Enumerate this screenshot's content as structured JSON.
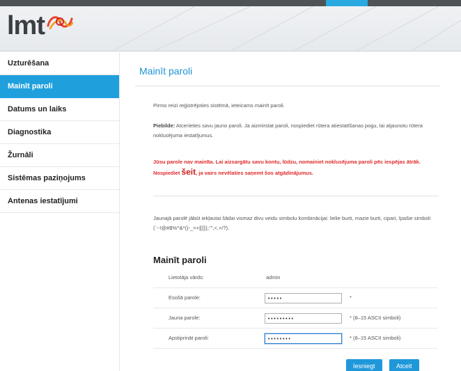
{
  "brand": {
    "logo_text": "lmt",
    "accent_color": "#1fa0dd",
    "warn_color": "#e02a2a"
  },
  "sidebar": {
    "items": [
      {
        "label": "Uzturēšana",
        "active": false
      },
      {
        "label": "Mainīt paroli",
        "active": true
      },
      {
        "label": "Datums un laiks",
        "active": false
      },
      {
        "label": "Diagnostika",
        "active": false
      },
      {
        "label": "Žurnāli",
        "active": false
      },
      {
        "label": "Sistēmas paziņojums",
        "active": false
      },
      {
        "label": "Antenas iestatījumi",
        "active": false
      }
    ]
  },
  "main": {
    "title": "Mainīt paroli",
    "intro": "Pirmo reizi reģistrējoties sistēmā, ieteicams mainīt paroli.",
    "note_label": "Piebilde:",
    "note_text": " Atcerieties savu jauno paroli. Ja aizmirstat paroli, nospiediet rūtera atiestatīšanas pogu, lai atjaunotu rūtera noklusējuma iestatījumus.",
    "warning_part1": "Jūsu parole nav mainīta. Lai aizsargātu savu kontu, lūdzu, nomainiet noklusējuma paroli pēc iespējas ātrāk. Nospiediet ",
    "warning_link": "šeit",
    "warning_part2": ", ja vairs nevēlaties saņemt šos atgādinājumus.",
    "rules_text": "Jaunajā parolē jābūt iekļautai šādai vismaz divu veidu simbolu kombinācijai: lielie burti, mazie burti, cipari, īpašie simboli (`~!@#$%^&*()-_=+|[{}];:'\",<.>/?).",
    "form": {
      "title": "Mainīt paroli",
      "username_label": "Lietotāja vārds:",
      "username_value": "admin",
      "current_label": "Esošā parole:",
      "current_value": "•••••",
      "current_hint": "*",
      "new_label": "Jauna parole:",
      "new_value": "•••••••••",
      "new_hint": "*  (8–15 ASCII simboli)",
      "confirm_label": "Apstiprināt paroli:",
      "confirm_value": "••••••••",
      "confirm_hint": "*  (8–15 ASCII simboli)"
    },
    "buttons": {
      "submit": "Iesniegt",
      "cancel": "Atcelt"
    }
  }
}
